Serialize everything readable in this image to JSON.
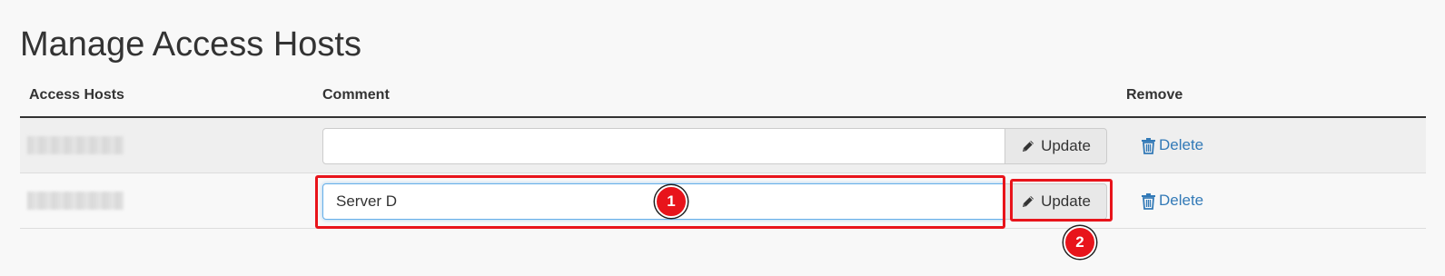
{
  "page": {
    "title": "Manage Access Hosts"
  },
  "table": {
    "headers": {
      "hosts": "Access Hosts",
      "comment": "Comment",
      "remove": "Remove"
    },
    "rows": [
      {
        "host": "",
        "comment_value": "",
        "update_label": "Update",
        "delete_label": "Delete"
      },
      {
        "host": "",
        "comment_value": "Server D",
        "update_label": "Update",
        "delete_label": "Delete"
      }
    ]
  },
  "annotations": {
    "badge_1": "1",
    "badge_2": "2",
    "color": "#e8141b"
  },
  "icons": {
    "update": "pencil-icon",
    "delete": "trash-icon"
  },
  "colors": {
    "link": "#337ab7",
    "focus_border": "#66afe9"
  }
}
